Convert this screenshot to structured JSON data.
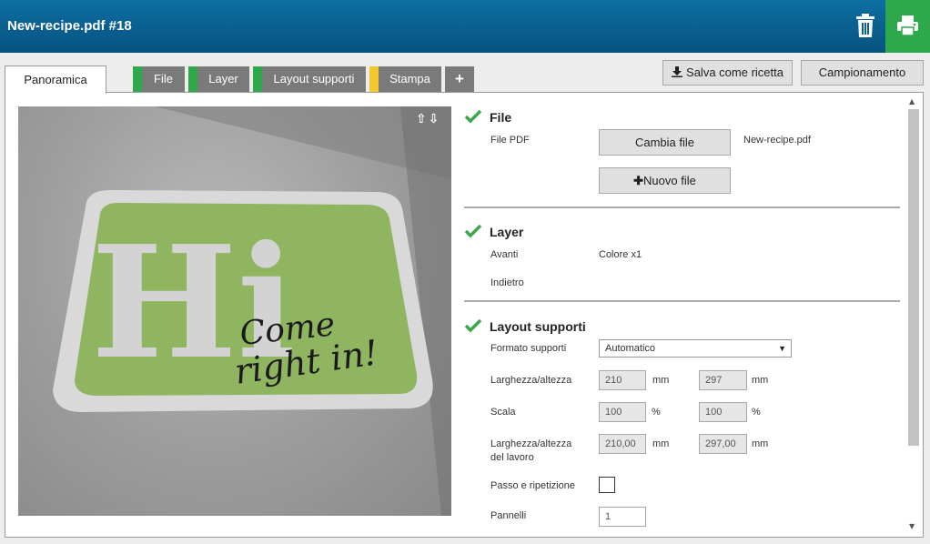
{
  "window": {
    "title": "New-recipe.pdf #18"
  },
  "icons": {
    "trash": "trash-icon",
    "print": "printer-icon",
    "add": "plus-icon",
    "download": "download-icon",
    "check": "check-icon"
  },
  "colors": {
    "header": "#0a5f93",
    "print": "#2da84a",
    "status_ok": "#2da84a",
    "status_warn": "#f2c62c",
    "check": "#3aa84a"
  },
  "tabs": [
    {
      "label": "Panoramica",
      "active": true
    },
    {
      "label": "File",
      "status": "ok"
    },
    {
      "label": "Layer",
      "status": "ok"
    },
    {
      "label": "Layout supporti",
      "status": "ok"
    },
    {
      "label": "Stampa",
      "status": "warn"
    },
    {
      "label": "+"
    }
  ],
  "toolbar": {
    "save_recipe": "Salva come ricetta",
    "sample": "Campionamento"
  },
  "preview": {
    "arrows": "⇧⇩",
    "artwork_main": "Hi",
    "artwork_line1": "Come",
    "artwork_line2": "right in!"
  },
  "sections": {
    "file": {
      "title": "File",
      "pdf_label": "File PDF",
      "change_button": "Cambia file",
      "filename": "New-recipe.pdf",
      "new_button": "Nuovo file"
    },
    "layer": {
      "title": "Layer",
      "front_label": "Avanti",
      "front_value": "Colore x1",
      "back_label": "Indietro"
    },
    "layout": {
      "title": "Layout supporti",
      "format_label": "Formato supporti",
      "format_value": "Automatico",
      "size_label": "Larghezza/altezza",
      "width": "210",
      "height": "297",
      "unit_mm": "mm",
      "scale_label": "Scala",
      "scale_x": "100",
      "scale_y": "100",
      "unit_pct": "%",
      "job_size_label_1": "Larghezza/altezza",
      "job_size_label_2": "del lavoro",
      "job_width": "210,00",
      "job_height": "297,00",
      "step_repeat_label": "Passo e ripetizione",
      "panels_label": "Pannelli",
      "panels_value": "1"
    }
  }
}
